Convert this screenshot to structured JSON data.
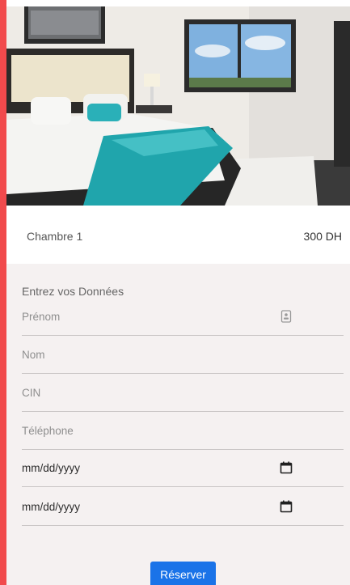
{
  "room": {
    "name": "Chambre 1",
    "price": "300 DH"
  },
  "form": {
    "heading": "Entrez vos Données",
    "fields": {
      "prenom": {
        "placeholder": "Prénom",
        "icon": "contact-card-icon"
      },
      "nom": {
        "placeholder": "Nom"
      },
      "cin": {
        "placeholder": "CIN"
      },
      "telephone": {
        "placeholder": "Téléphone"
      },
      "date_start": {
        "value": "mm/dd/yyyy",
        "icon": "calendar-icon"
      },
      "date_end": {
        "value": "mm/dd/yyyy",
        "icon": "calendar-icon"
      }
    },
    "submit_label": "Réserver"
  },
  "colors": {
    "accent_bar": "#f14a4c",
    "button": "#1a73e8",
    "form_background": "#f5f1f1"
  }
}
